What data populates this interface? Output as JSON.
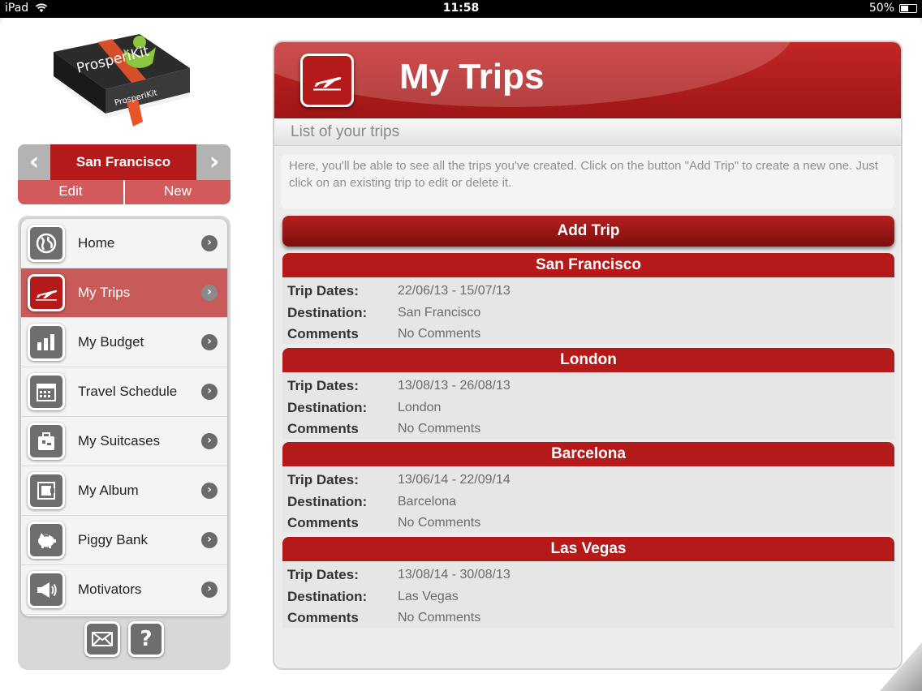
{
  "status_bar": {
    "device": "iPad",
    "time": "11:58",
    "battery": "50%"
  },
  "logo": {
    "text_top": "ProsperiKit",
    "text_side": "ProsperiKit"
  },
  "trip_selector": {
    "current": "San Francisco",
    "edit_label": "Edit",
    "new_label": "New",
    "prev_icon": "chevron-left-icon",
    "next_icon": "chevron-right-icon"
  },
  "nav": {
    "items": [
      {
        "label": "Home",
        "icon": "globe-icon"
      },
      {
        "label": "My Trips",
        "icon": "airplane-icon",
        "active": true
      },
      {
        "label": "My Budget",
        "icon": "bar-chart-icon"
      },
      {
        "label": "Travel Schedule",
        "icon": "calendar-icon"
      },
      {
        "label": "My Suitcases",
        "icon": "suitcase-icon"
      },
      {
        "label": "My Album",
        "icon": "album-icon"
      },
      {
        "label": "Piggy Bank",
        "icon": "piggy-bank-icon"
      },
      {
        "label": "Motivators",
        "icon": "megaphone-icon"
      }
    ],
    "footer": {
      "mail_icon": "mail-icon",
      "help_label": "?"
    }
  },
  "main": {
    "title": "My Trips",
    "subtitle": "List of your trips",
    "description": "Here, you'll be able to see all the trips you've created. Click on the button \"Add Trip\" to create a new one. Just click on an existing trip to edit or delete it.",
    "add_trip_label": "Add Trip",
    "field_labels": {
      "dates": "Trip Dates:",
      "destination": "Destination:",
      "comments": "Comments"
    },
    "trips": [
      {
        "name": "San Francisco",
        "dates": "22/06/13 - 15/07/13",
        "destination": "San Francisco",
        "comments": "No Comments"
      },
      {
        "name": "London",
        "dates": "13/08/13 - 26/08/13",
        "destination": "London",
        "comments": "No Comments"
      },
      {
        "name": "Barcelona",
        "dates": "13/06/14 - 22/09/14",
        "destination": "Barcelona",
        "comments": "No Comments"
      },
      {
        "name": "Las Vegas",
        "dates": "13/08/14 - 30/08/13",
        "destination": "Las Vegas",
        "comments": "No Comments"
      }
    ]
  },
  "colors": {
    "brand_red": "#b41a1a",
    "active_item": "#c85a5a",
    "icon_gray": "#6e6e6e"
  }
}
